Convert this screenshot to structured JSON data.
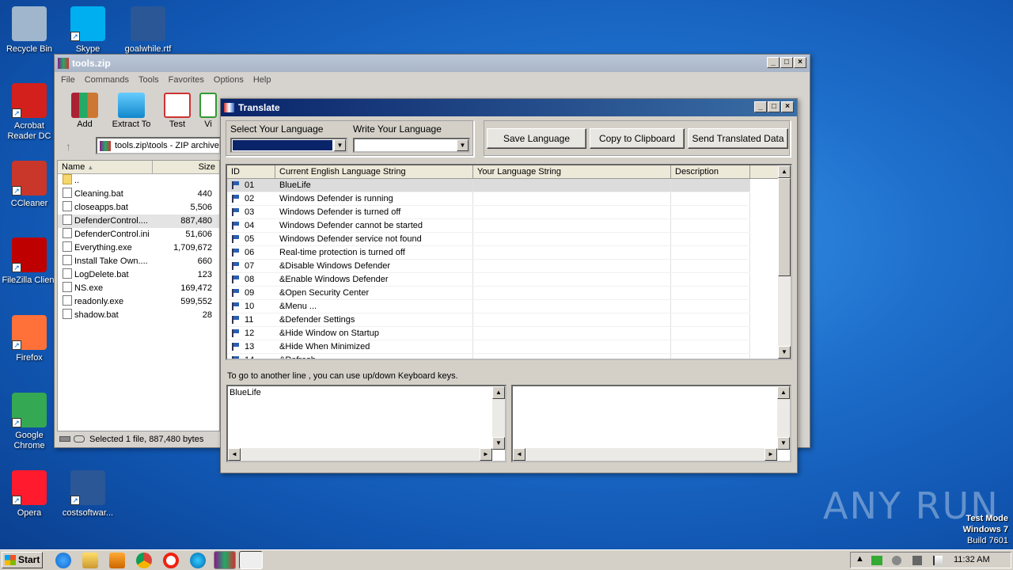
{
  "desktop": {
    "icons": [
      {
        "label": "Recycle Bin",
        "color": "#9fb6cc"
      },
      {
        "label": "Skype",
        "color": "#00aff0"
      },
      {
        "label": "goalwhile.rtf",
        "color": "#2b5797"
      },
      {
        "label": "Acrobat Reader DC",
        "color": "#d3201d"
      },
      {
        "label": "CCleaner",
        "color": "#c8372a"
      },
      {
        "label": "FileZilla Client",
        "color": "#bf0000"
      },
      {
        "label": "Firefox",
        "color": "#ff7139"
      },
      {
        "label": "Google Chrome",
        "color": "#34a853"
      },
      {
        "label": "Opera",
        "color": "#ff1b2d"
      },
      {
        "label": "costsoftwar...",
        "color": "#2b5797"
      }
    ],
    "watermark": "ANY RUN",
    "os_info": {
      "line1": "Test Mode",
      "line2": "Windows 7",
      "line3": "Build 7601"
    }
  },
  "winrar": {
    "title": "tools.zip",
    "menu": [
      "File",
      "Commands",
      "Tools",
      "Favorites",
      "Options",
      "Help"
    ],
    "toolbar": [
      "Add",
      "Extract To",
      "Test",
      "Vi"
    ],
    "address": "tools.zip\\tools - ZIP archive",
    "columns": {
      "name": "Name",
      "size": "Size"
    },
    "files": [
      {
        "name": "..",
        "size": ""
      },
      {
        "name": "Cleaning.bat",
        "size": "440"
      },
      {
        "name": "closeapps.bat",
        "size": "5,506"
      },
      {
        "name": "DefenderControl....",
        "size": "887,480"
      },
      {
        "name": "DefenderControl.ini",
        "size": "51,606"
      },
      {
        "name": "Everything.exe",
        "size": "1,709,672"
      },
      {
        "name": "Install Take Own....",
        "size": "660"
      },
      {
        "name": "LogDelete.bat",
        "size": "123"
      },
      {
        "name": "NS.exe",
        "size": "169,472"
      },
      {
        "name": "readonly.exe",
        "size": "599,552"
      },
      {
        "name": "shadow.bat",
        "size": "28"
      }
    ],
    "status": "Selected 1 file, 887,480 bytes"
  },
  "translate": {
    "title": "Translate",
    "select_language_label": "Select Your Language",
    "write_language_label": "Write Your Language",
    "save_button": "Save Language",
    "copy_button": "Copy to Clipboard",
    "send_button": "Send Translated Data",
    "columns": {
      "id": "ID",
      "english": "Current English Language String",
      "yours": "Your Language String",
      "desc": "Description"
    },
    "rows": [
      {
        "id": "01",
        "text": "BlueLife"
      },
      {
        "id": "02",
        "text": "Windows Defender is running"
      },
      {
        "id": "03",
        "text": "Windows Defender is turned off"
      },
      {
        "id": "04",
        "text": "Windows Defender cannot be started"
      },
      {
        "id": "05",
        "text": "Windows Defender service not found"
      },
      {
        "id": "06",
        "text": "Real-time protection is turned off"
      },
      {
        "id": "07",
        "text": "&Disable Windows Defender"
      },
      {
        "id": "08",
        "text": "&Enable Windows Defender"
      },
      {
        "id": "09",
        "text": "&Open Security Center"
      },
      {
        "id": "10",
        "text": "&Menu ..."
      },
      {
        "id": "11",
        "text": "&Defender Settings"
      },
      {
        "id": "12",
        "text": "&Hide Window on Startup"
      },
      {
        "id": "13",
        "text": "&Hide When Minimized"
      },
      {
        "id": "14",
        "text": "&Refresh"
      }
    ],
    "hint": "To go to another line , you can use up/down Keyboard keys.",
    "source_text": "BlueLife",
    "target_text": ""
  },
  "taskbar": {
    "start": "Start",
    "clock": "11:32 AM"
  }
}
